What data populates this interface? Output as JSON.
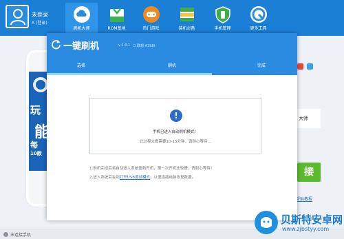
{
  "header": {
    "login_title": "未登录",
    "login_sub": "A (登录)",
    "nav": [
      {
        "label": "刷机大师",
        "icon": "cloud-icon",
        "color": "#ffffff"
      },
      {
        "label": "ROM基地",
        "icon": "shopping-bag-icon",
        "color": "#3bb34a"
      },
      {
        "label": "热门游戏",
        "icon": "gamepad-icon",
        "color": "#f08a1c"
      },
      {
        "label": "装机必备",
        "icon": "box-icon",
        "color": "#3fae49"
      },
      {
        "label": "手机管理",
        "icon": "shield-icon",
        "color": "#3fae49"
      },
      {
        "label": "更多工具",
        "icon": "wrench-icon",
        "color": "#2e8fd8"
      }
    ]
  },
  "background_app": {
    "promo_line1": "玩",
    "promo_line2": "能",
    "promo_line3": "每",
    "promo_line4": "10款",
    "right_card_text": "大师",
    "connect_button": "接",
    "help_link": "帮助教程",
    "status": "未连接手机"
  },
  "modal": {
    "title": "一键刷机",
    "version": "v 1.0.1",
    "model": "☐ 联想 A298t",
    "tabs": [
      {
        "label": "选择"
      },
      {
        "label": "刷机"
      },
      {
        "label": "完成"
      }
    ],
    "progress": 0.66,
    "alert_icon": "!",
    "message_main": "手机已进入自动刷机模式！",
    "message_sub": "此过程大概需要10-15分钟，请耐心等待…",
    "note1": "1.刷机完成后将自动进入系统重新开机，第一次开机比较慢，请耐心等待！",
    "note2_before": "2.进入系统后会到",
    "note2_link": "打开USB调试模式",
    "note2_after": "，以便连接电脑恢复数据。"
  },
  "watermark": {
    "title": "贝斯特安卓网",
    "url": "www.zjbstyy.com"
  }
}
